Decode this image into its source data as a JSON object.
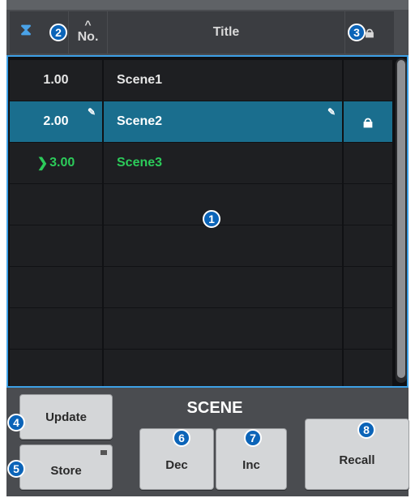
{
  "header": {
    "no_label": "No.",
    "title_label": "Title",
    "sort_caret": "^",
    "hourglass_icon": "hourglass-icon",
    "lock_icon": "lock-icon"
  },
  "rows": [
    {
      "no": "1.00",
      "title": "Scene1",
      "selected": false,
      "current": false,
      "locked": false
    },
    {
      "no": "2.00",
      "title": "Scene2",
      "selected": true,
      "current": false,
      "locked": true
    },
    {
      "no": "3.00",
      "title": "Scene3",
      "selected": false,
      "current": true,
      "locked": false
    },
    {
      "no": "",
      "title": ""
    },
    {
      "no": "",
      "title": ""
    },
    {
      "no": "",
      "title": ""
    },
    {
      "no": "",
      "title": ""
    },
    {
      "no": "",
      "title": ""
    }
  ],
  "controls": {
    "scene_label": "SCENE",
    "update_label": "Update",
    "store_label": "Store",
    "dec_label": "Dec",
    "inc_label": "Inc",
    "recall_label": "Recall"
  },
  "callouts": [
    "1",
    "2",
    "3",
    "4",
    "5",
    "6",
    "7",
    "8"
  ],
  "colors": {
    "selected_row": "#1a6e8e",
    "current_scene": "#2ccb5a",
    "list_border": "#3da0e6",
    "badge": "#0b64b8"
  }
}
